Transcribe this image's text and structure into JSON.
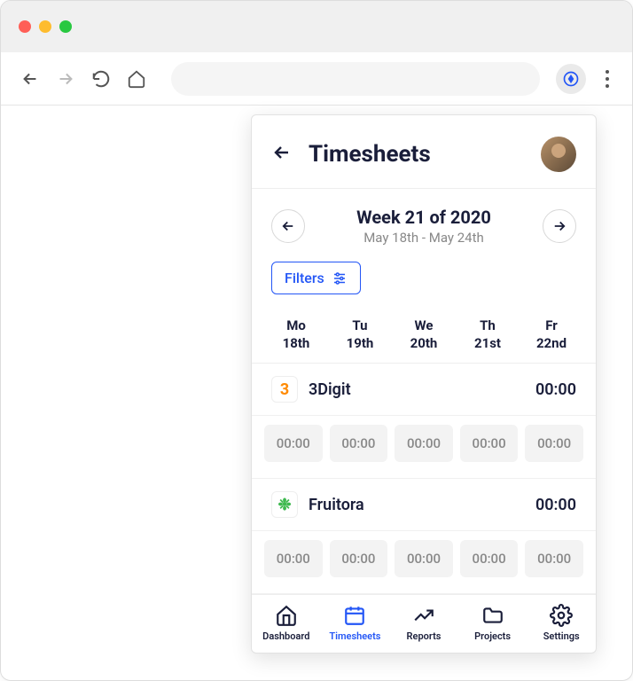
{
  "header": {
    "title": "Timesheets"
  },
  "week": {
    "title": "Week 21 of 2020",
    "range": "May 18th - May 24th"
  },
  "filters": {
    "label": "Filters"
  },
  "days": [
    {
      "abbr": "Mo",
      "date": "18th"
    },
    {
      "abbr": "Tu",
      "date": "19th"
    },
    {
      "abbr": "We",
      "date": "20th"
    },
    {
      "abbr": "Th",
      "date": "21st"
    },
    {
      "abbr": "Fr",
      "date": "22nd"
    }
  ],
  "projects": [
    {
      "name": "3Digit",
      "icon_glyph": "3",
      "icon_color": "orange",
      "total": "00:00",
      "cells": [
        "00:00",
        "00:00",
        "00:00",
        "00:00",
        "00:00"
      ]
    },
    {
      "name": "Fruitora",
      "icon_glyph": "❉",
      "icon_color": "green",
      "total": "00:00",
      "cells": [
        "00:00",
        "00:00",
        "00:00",
        "00:00",
        "00:00"
      ]
    }
  ],
  "nav": {
    "dashboard": "Dashboard",
    "timesheets": "Timesheets",
    "reports": "Reports",
    "projects": "Projects",
    "settings": "Settings"
  }
}
